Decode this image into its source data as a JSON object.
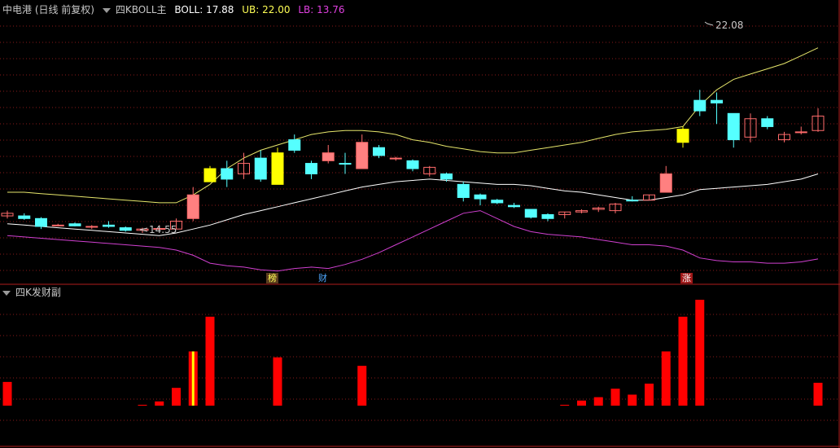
{
  "top_panel": {
    "stock_label": "中电港 (日线 前复权)",
    "indicator_name": "四KBOLL主",
    "boll_label": "BOLL: 17.88",
    "ub_label": "UB: 22.00",
    "lb_label": "LB: 13.76",
    "high_annotation": "22.08",
    "low_annotation": "14.55",
    "events": [
      {
        "label": "榜",
        "color": "#ffff55",
        "bg": "#5a3c1e"
      },
      {
        "label": "财",
        "color": "#4fa8ff",
        "bg": "#000000"
      },
      {
        "label": "涨",
        "color": "#ffffff",
        "bg": "#a01818"
      }
    ]
  },
  "bottom_panel": {
    "indicator_name": "四K发财副"
  },
  "colors": {
    "up": "#ff6b6b",
    "up_fill": "#ff8080",
    "down": "#55ffff",
    "signal": "#ffff00",
    "mid_line": "#ffffff",
    "upper_line": "#e6e66b",
    "lower_line": "#d040d0",
    "bar": "#ff0000",
    "grid": "#8a1a1a"
  },
  "chart_data": [
    {
      "type": "candlestick",
      "title": "四KBOLL主",
      "ylim": [
        13.2,
        23.0
      ],
      "candles": [
        {
          "o": 15.5,
          "h": 15.6,
          "l": 15.3,
          "c": 15.4,
          "t": "up"
        },
        {
          "o": 15.4,
          "h": 15.5,
          "l": 15.25,
          "c": 15.3,
          "t": "down"
        },
        {
          "o": 15.3,
          "h": 15.35,
          "l": 14.9,
          "c": 15.0,
          "t": "down"
        },
        {
          "o": 15.05,
          "h": 15.1,
          "l": 15.0,
          "c": 15.05,
          "t": "up"
        },
        {
          "o": 15.1,
          "h": 15.15,
          "l": 15.0,
          "c": 15.02,
          "t": "down"
        },
        {
          "o": 15.0,
          "h": 15.05,
          "l": 14.9,
          "c": 15.0,
          "t": "up"
        },
        {
          "o": 15.05,
          "h": 15.2,
          "l": 14.95,
          "c": 15.0,
          "t": "down"
        },
        {
          "o": 14.95,
          "h": 15.0,
          "l": 14.8,
          "c": 14.85,
          "t": "down"
        },
        {
          "o": 14.85,
          "h": 14.95,
          "l": 14.75,
          "c": 14.9,
          "t": "up"
        },
        {
          "o": 14.92,
          "h": 15.05,
          "l": 14.85,
          "c": 14.92,
          "t": "up"
        },
        {
          "o": 14.9,
          "h": 15.3,
          "l": 14.9,
          "c": 15.2,
          "t": "up"
        },
        {
          "o": 15.3,
          "h": 16.5,
          "l": 15.2,
          "c": 16.2,
          "t": "up_fill"
        },
        {
          "o": 17.2,
          "h": 17.3,
          "l": 16.7,
          "c": 16.7,
          "t": "signal"
        },
        {
          "o": 16.8,
          "h": 17.5,
          "l": 16.5,
          "c": 17.2,
          "t": "down"
        },
        {
          "o": 17.0,
          "h": 17.8,
          "l": 16.8,
          "c": 17.4,
          "t": "up"
        },
        {
          "o": 17.6,
          "h": 17.9,
          "l": 16.7,
          "c": 16.8,
          "t": "down"
        },
        {
          "o": 16.6,
          "h": 18.0,
          "l": 16.6,
          "c": 17.8,
          "t": "signal"
        },
        {
          "o": 17.9,
          "h": 18.5,
          "l": 17.8,
          "c": 18.3,
          "t": "down"
        },
        {
          "o": 17.4,
          "h": 17.5,
          "l": 16.8,
          "c": 17.0,
          "t": "down"
        },
        {
          "o": 17.5,
          "h": 18.1,
          "l": 17.4,
          "c": 17.8,
          "t": "up_fill"
        },
        {
          "o": 17.4,
          "h": 17.8,
          "l": 17.0,
          "c": 17.4,
          "t": "down"
        },
        {
          "o": 17.2,
          "h": 18.5,
          "l": 17.2,
          "c": 18.2,
          "t": "up_fill"
        },
        {
          "o": 18.0,
          "h": 18.1,
          "l": 17.6,
          "c": 17.7,
          "t": "down"
        },
        {
          "o": 17.6,
          "h": 17.65,
          "l": 17.5,
          "c": 17.6,
          "t": "up"
        },
        {
          "o": 17.5,
          "h": 17.55,
          "l": 17.1,
          "c": 17.2,
          "t": "down"
        },
        {
          "o": 17.0,
          "h": 17.3,
          "l": 16.9,
          "c": 17.25,
          "t": "up"
        },
        {
          "o": 17.0,
          "h": 17.05,
          "l": 16.7,
          "c": 16.8,
          "t": "down"
        },
        {
          "o": 16.6,
          "h": 16.7,
          "l": 15.95,
          "c": 16.1,
          "t": "down"
        },
        {
          "o": 16.2,
          "h": 16.25,
          "l": 15.8,
          "c": 16.05,
          "t": "down"
        },
        {
          "o": 16.0,
          "h": 16.05,
          "l": 15.85,
          "c": 15.9,
          "t": "down"
        },
        {
          "o": 15.8,
          "h": 15.9,
          "l": 15.7,
          "c": 15.75,
          "t": "down"
        },
        {
          "o": 15.65,
          "h": 15.65,
          "l": 15.3,
          "c": 15.35,
          "t": "down"
        },
        {
          "o": 15.45,
          "h": 15.5,
          "l": 15.2,
          "c": 15.3,
          "t": "down"
        },
        {
          "o": 15.45,
          "h": 15.55,
          "l": 15.3,
          "c": 15.55,
          "t": "up"
        },
        {
          "o": 15.55,
          "h": 15.65,
          "l": 15.5,
          "c": 15.6,
          "t": "up"
        },
        {
          "o": 15.65,
          "h": 15.75,
          "l": 15.55,
          "c": 15.7,
          "t": "up"
        },
        {
          "o": 15.6,
          "h": 15.9,
          "l": 15.5,
          "c": 15.85,
          "t": "up"
        },
        {
          "o": 16.0,
          "h": 16.15,
          "l": 15.95,
          "c": 16.0,
          "t": "down"
        },
        {
          "o": 16.0,
          "h": 16.2,
          "l": 16.0,
          "c": 16.2,
          "t": "up"
        },
        {
          "o": 16.3,
          "h": 17.3,
          "l": 16.3,
          "c": 17.0,
          "t": "up_fill"
        },
        {
          "o": 18.7,
          "h": 18.8,
          "l": 18.0,
          "c": 18.2,
          "t": "signal"
        },
        {
          "o": 19.8,
          "h": 20.2,
          "l": 19.2,
          "c": 19.4,
          "t": "down"
        },
        {
          "o": 19.8,
          "h": 20.1,
          "l": 18.9,
          "c": 19.7,
          "t": "down"
        },
        {
          "o": 19.3,
          "h": 19.3,
          "l": 18.0,
          "c": 18.3,
          "t": "down"
        },
        {
          "o": 18.4,
          "h": 19.3,
          "l": 18.2,
          "c": 19.1,
          "t": "up"
        },
        {
          "o": 19.1,
          "h": 19.2,
          "l": 18.7,
          "c": 18.8,
          "t": "down"
        },
        {
          "o": 18.3,
          "h": 18.6,
          "l": 18.2,
          "c": 18.5,
          "t": "up"
        },
        {
          "o": 18.6,
          "h": 18.8,
          "l": 18.5,
          "c": 18.6,
          "t": "up"
        },
        {
          "o": 18.65,
          "h": 19.5,
          "l": 18.6,
          "c": 19.2,
          "t": "up"
        }
      ],
      "series": [
        {
          "name": "BOLL",
          "values": [
            15.1,
            15.05,
            15.0,
            14.95,
            14.9,
            14.85,
            14.8,
            14.75,
            14.7,
            14.65,
            14.75,
            14.9,
            15.05,
            15.25,
            15.45,
            15.6,
            15.75,
            15.9,
            16.05,
            16.2,
            16.35,
            16.5,
            16.6,
            16.7,
            16.75,
            16.8,
            16.75,
            16.7,
            16.65,
            16.6,
            16.6,
            16.55,
            16.45,
            16.35,
            16.3,
            16.2,
            16.1,
            16.0,
            16.0,
            16.1,
            16.2,
            16.4,
            16.45,
            16.5,
            16.55,
            16.6,
            16.7,
            16.8,
            17.0
          ]
        },
        {
          "name": "UB",
          "values": [
            16.3,
            16.3,
            16.25,
            16.2,
            16.15,
            16.1,
            16.05,
            16.0,
            15.95,
            15.9,
            15.9,
            16.2,
            16.6,
            17.2,
            17.6,
            17.9,
            18.1,
            18.3,
            18.5,
            18.6,
            18.65,
            18.65,
            18.6,
            18.5,
            18.3,
            18.2,
            18.05,
            17.95,
            17.85,
            17.8,
            17.8,
            17.9,
            18.0,
            18.1,
            18.2,
            18.35,
            18.5,
            18.6,
            18.65,
            18.7,
            18.8,
            19.6,
            20.2,
            20.6,
            20.8,
            21.0,
            21.2,
            21.5,
            21.8
          ]
        },
        {
          "name": "LB",
          "values": [
            14.65,
            14.6,
            14.55,
            14.5,
            14.45,
            14.4,
            14.35,
            14.3,
            14.25,
            14.2,
            14.1,
            13.9,
            13.6,
            13.5,
            13.45,
            13.35,
            13.3,
            13.4,
            13.45,
            13.4,
            13.55,
            13.75,
            14.0,
            14.3,
            14.6,
            14.9,
            15.2,
            15.5,
            15.6,
            15.3,
            15.0,
            14.8,
            14.7,
            14.65,
            14.6,
            14.5,
            14.4,
            14.3,
            14.3,
            14.25,
            14.1,
            13.8,
            13.7,
            13.65,
            13.65,
            13.6,
            13.6,
            13.65,
            13.76
          ]
        }
      ]
    },
    {
      "type": "bar",
      "title": "四K发财副",
      "ylim": [
        0,
        125
      ],
      "values": [
        28,
        0,
        0,
        0,
        0,
        0,
        0,
        0,
        1,
        5,
        21,
        64,
        105,
        0,
        0,
        0,
        57,
        0,
        0,
        0,
        0,
        47,
        0,
        0,
        0,
        0,
        0,
        0,
        0,
        0,
        0,
        0,
        0,
        1,
        6,
        10,
        20,
        13,
        26,
        64,
        105,
        125,
        0,
        0,
        0,
        0,
        0,
        0,
        27
      ],
      "highlight": [
        false,
        false,
        false,
        false,
        false,
        false,
        false,
        false,
        false,
        false,
        false,
        true,
        false,
        false,
        false,
        false,
        false,
        false,
        false,
        false,
        false,
        false,
        false,
        false,
        false,
        false,
        false,
        false,
        false,
        false,
        false,
        false,
        false,
        false,
        false,
        false,
        false,
        false,
        false,
        false,
        false,
        false,
        false,
        false,
        false,
        false,
        false,
        false,
        false
      ]
    }
  ]
}
